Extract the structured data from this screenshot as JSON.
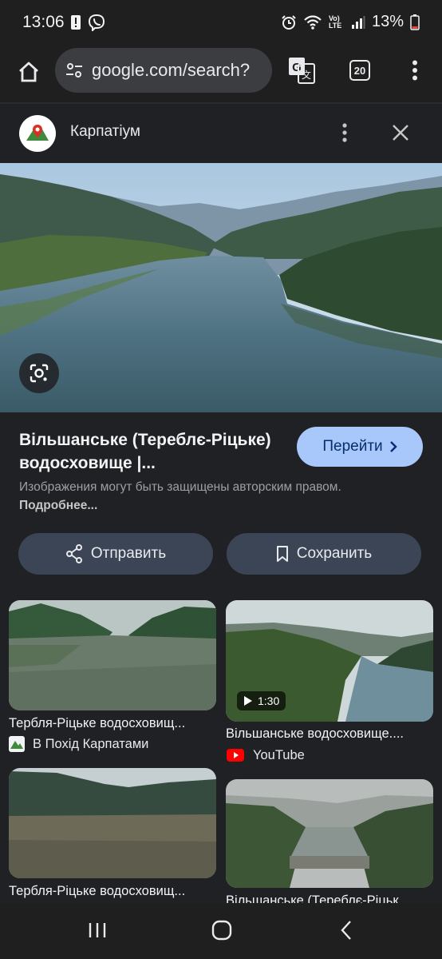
{
  "status_bar": {
    "time": "13:06",
    "battery": "13%",
    "network_label": "Vo) LTE"
  },
  "toolbar": {
    "url": "google.com/search?",
    "tab_count": "20"
  },
  "panel": {
    "site_name": "Карпатіум",
    "title": "Вільшанське (Тереблє-Ріцьке) водосховище |...",
    "go_label": "Перейти",
    "copyright_text": "Изображения могут быть защищены авторским правом.",
    "copyright_link": "Подробнее...",
    "share_label": "Отправить",
    "save_label": "Сохранить"
  },
  "related": [
    {
      "title": "Тербля-Ріцьке водосховищ...",
      "source": "В Похід Карпатами",
      "source_icon": "mountain-icon"
    },
    {
      "title": "Вільшанське водосховище....",
      "source": "YouTube",
      "source_icon": "youtube-icon",
      "duration": "1:30"
    },
    {
      "title": "Тербля-Ріцьке водосховищ...",
      "source": "",
      "source_icon": ""
    },
    {
      "title": "Вільшанське (Тереблє-Ріцьк...",
      "source": "",
      "source_icon": ""
    }
  ],
  "colors": {
    "accent_button": "#a8c7fa",
    "secondary_button": "#3c4555",
    "background": "#202124"
  }
}
